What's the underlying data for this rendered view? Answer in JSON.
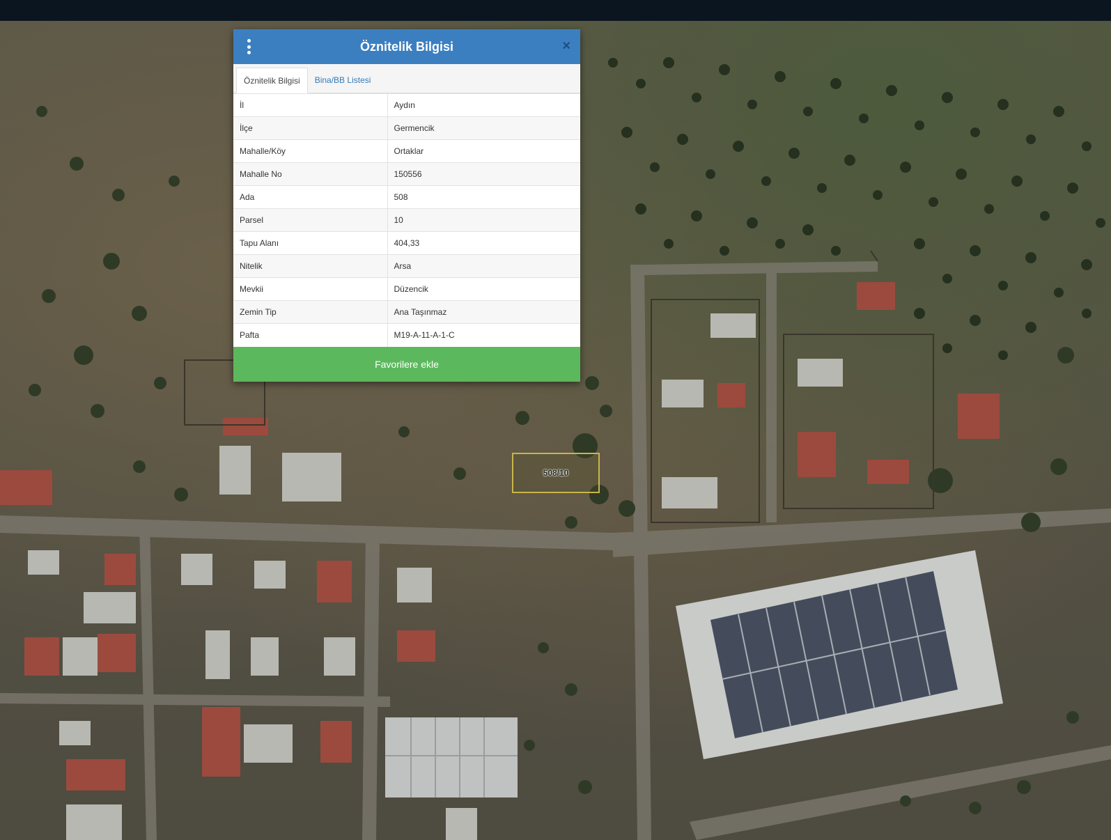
{
  "dialog": {
    "title": "Öznitelik Bilgisi",
    "menu_icon": "vertical-dots-icon",
    "close_icon": "close-icon",
    "close_glyph": "×",
    "tabs": [
      {
        "label": "Öznitelik Bilgisi",
        "active": true
      },
      {
        "label": "Bina/BB Listesi",
        "active": false
      }
    ],
    "rows": [
      {
        "key": "İl",
        "value": "Aydın"
      },
      {
        "key": "İlçe",
        "value": "Germencik"
      },
      {
        "key": "Mahalle/Köy",
        "value": "Ortaklar"
      },
      {
        "key": "Mahalle No",
        "value": "150556"
      },
      {
        "key": "Ada",
        "value": "508"
      },
      {
        "key": "Parsel",
        "value": "10"
      },
      {
        "key": "Tapu Alanı",
        "value": "404,33"
      },
      {
        "key": "Nitelik",
        "value": "Arsa"
      },
      {
        "key": "Mevkii",
        "value": "Düzencik"
      },
      {
        "key": "Zemin Tip",
        "value": "Ana Taşınmaz"
      },
      {
        "key": "Pafta",
        "value": "M19-A-11-A-1-C"
      }
    ],
    "favorite_button": "Favorilere ekle"
  },
  "map": {
    "parcel_label": "508/10"
  },
  "colors": {
    "header": "#3b7fc1",
    "favorite": "#5cb85c",
    "parcel_outline": "#c9b64a",
    "topbar": "#0b1520"
  }
}
